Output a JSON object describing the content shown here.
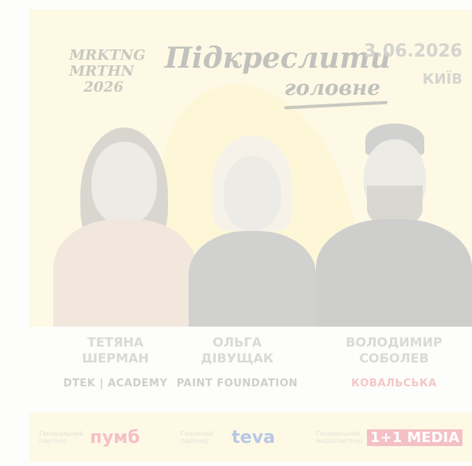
{
  "event": {
    "mark_lines": [
      "MRKTNG",
      "MRTHN",
      "2026"
    ],
    "headline_line1": "Підкреслити",
    "headline_line2": "головне",
    "date": "3.06.2026",
    "city": "КИЇВ"
  },
  "speakers": [
    {
      "name_line1": "ТЕТЯНА",
      "name_line2": "ШЕРМАН",
      "org": "DTEK | ACADEMY"
    },
    {
      "name_line1": "ОЛЬГА",
      "name_line2": "ДІВУЩАК",
      "org": "PAINT  FOUNDATION"
    },
    {
      "name_line1": "ВОЛОДИМИР",
      "name_line2": "СОБОЛЕВ",
      "org": "КОВАЛЬСЬКА"
    }
  ],
  "partners": [
    {
      "role": "Генеральний партнер",
      "brand": "пумб"
    },
    {
      "role": "Головний партнер",
      "brand": "teva"
    },
    {
      "role": "Генеральний медіапартнер",
      "brand": "1+1 MEDIA"
    }
  ],
  "colors": {
    "accent_yellow": "#fef3b4",
    "partner_red": "#e3334f",
    "partner_blue": "#1f4fb8"
  }
}
